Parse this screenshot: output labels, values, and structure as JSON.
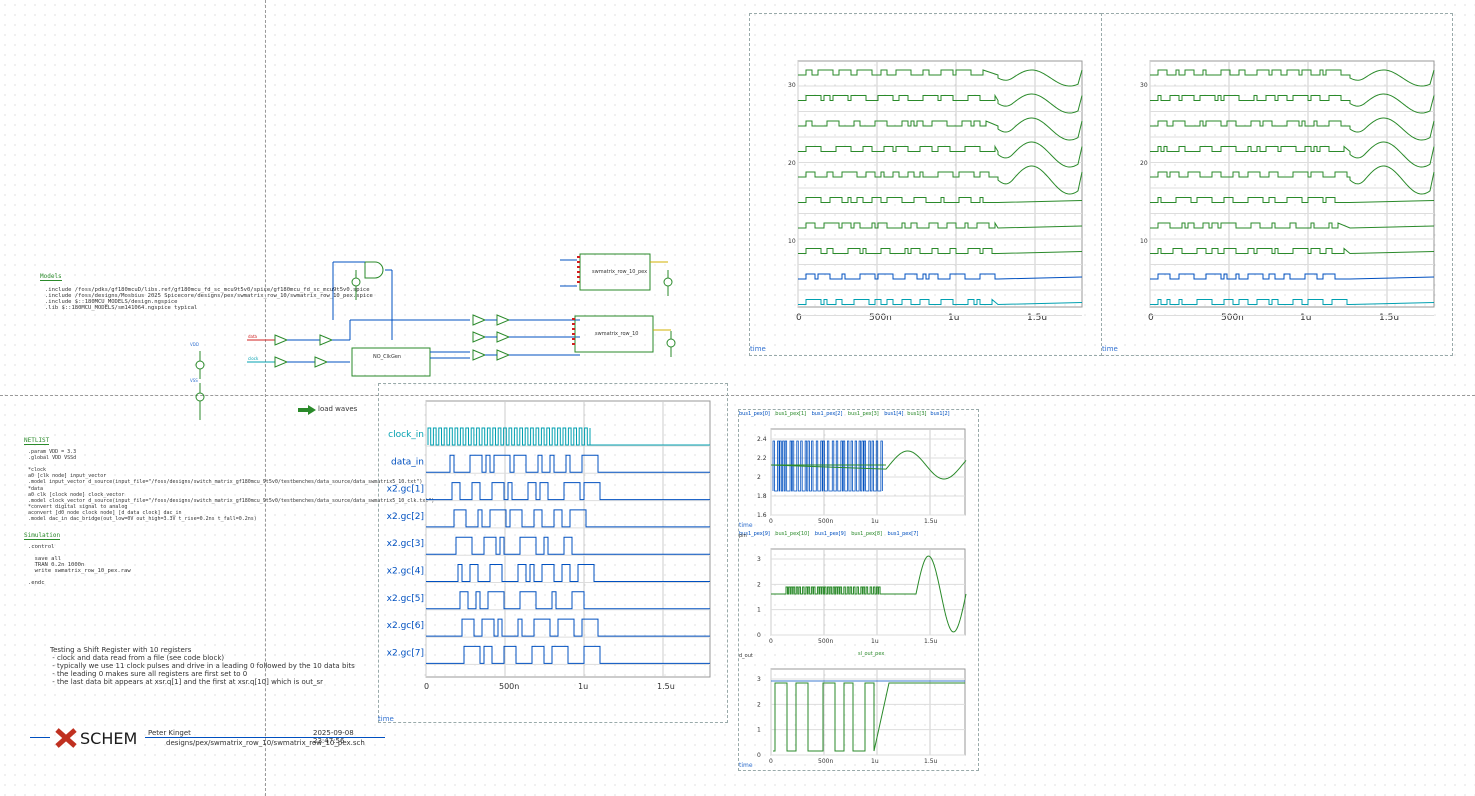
{
  "title": "",
  "model_block": {
    "header": "Models",
    "lines": [
      ".include /foss/pdks/gf180mcuD/libs.ref/gf180mcu_fd_sc_mcu9t5v0/spice/gf180mcu_fd_sc_mcu9t5v0.spice",
      ".include /foss/designs/Mosbius 2025 Spicecore/designs/pex/swmatrix_row_10/swmatrix_row_10_pex.spice",
      ".include $::180MCU_MODELS/design.ngspice",
      ".lib $::180MCU_MODELS/sm141064.ngspice typical"
    ]
  },
  "netlist_block": {
    "header": "NETLIST",
    "lines": [
      ".param VDD = 3.3",
      ".global VDD VSSd",
      "",
      "*clock",
      "a0 [clk node] input_vector",
      ".model input_vector d_source(input_file=\"/foss/designs/switch_matrix_gf180mcu_9t5v0/testbenches/data_source/data_swmatrix5_10.txt\")",
      "*data",
      "a0 clk [clock node] clock_vector",
      ".model clock_vector d_source(input_file=\"/foss/designs/switch_matrix_gf180mcu_9t5v0/testbenches/data_source/data_swmatrix5_10_clk.txt\")",
      "*convert digital signal to analog",
      "aconvert [d0 node clock node] [d data clock] dac_in",
      ".model dac_in dac_bridge(out_low=0V out_high=3.3V t_rise=0.2ns t_fall=0.2ns)"
    ]
  },
  "simulation_block": {
    "header": "Simulation",
    "lines": [
      ".control",
      "",
      "  save all",
      "  TRAN 0.2n 1000n",
      "  write swmatrix_row_10_pex.raw",
      "",
      ".endc"
    ]
  },
  "description": {
    "lines": [
      "Testing a Shift Register with 10 registers",
      " - clock and data read from a file (see code block)",
      " - typically we use 11 clock pulses and drive in a leading 0 followed by the 10 data bits",
      " - the leading 0 makes sure all registers are first set to 0",
      " - the last data bit appears at xsr.q[1] and the first at xsr.q[10] which is out_sr"
    ]
  },
  "footer": {
    "logo": "SCHEM",
    "author": "Peter Kinget",
    "date": "2025-09-08  23:47:56",
    "path": "designs/pex/swmatrix_row_10/swmatrix_row_10_pex.sch"
  },
  "load_waves_label": "load waves",
  "schematic": {
    "block_nocl": "NO_ClkGen",
    "block_row": "swmatrix_row_10",
    "block_row_pex": "swmatrix_row_10_pex",
    "net_data": "data",
    "net_clock": "clock",
    "label_vdd": "VDD",
    "label_vss": "VSS"
  },
  "waveform_main": {
    "time_label": "time",
    "x_ticks": [
      "0",
      "500n",
      "1u",
      "1.5u"
    ],
    "signals": [
      "clock_in",
      "data_in",
      "x2.gc[1]",
      "x2.gc[2]",
      "x2.gc[3]",
      "x2.gc[4]",
      "x2.gc[5]",
      "x2.gc[6]",
      "x2.gc[7]"
    ]
  },
  "waveform_top_left": {
    "time_label": "time",
    "x_ticks": [
      "0",
      "500n",
      "1u",
      "1.5u"
    ],
    "y_ticks": [
      "30",
      "20",
      "10"
    ]
  },
  "waveform_top_right": {
    "time_label": "time",
    "x_ticks": [
      "0",
      "500n",
      "1u",
      "1.5u"
    ],
    "y_ticks": [
      "30",
      "20",
      "10"
    ]
  },
  "waveform_small_1": {
    "legend": [
      "bus1_pex[0]",
      "bus1_pex[1]",
      "bus1_pex[2]",
      "bus1_pex[3]",
      "bus1[4]",
      "bus1[3]",
      "bus1[2]"
    ],
    "y_ticks": [
      "2.4",
      "2.2",
      "2",
      "1.8",
      "1.6"
    ],
    "x_ticks": [
      "0",
      "500n",
      "1u",
      "1.5u"
    ],
    "time_label": "time"
  },
  "waveform_small_2": {
    "side_label": "pin",
    "legend": [
      "bus1_pex[9]",
      "bus1_pex[10]",
      "bus1_pex[9]",
      "bus1_pex[8]",
      "bus1_pex[7]"
    ],
    "y_ticks": [
      "3",
      "2",
      "1",
      "0"
    ],
    "x_ticks": [
      "0",
      "500n",
      "1u",
      "1.5u"
    ]
  },
  "waveform_small_3": {
    "side_label": "d_out",
    "title": "sl_out_pex",
    "y_ticks": [
      "3",
      "2",
      "1",
      "0"
    ],
    "x_ticks": [
      "0",
      "500n",
      "1u",
      "1.5u"
    ],
    "time_label": "time"
  },
  "colors": {
    "green": "#2a8a2a",
    "blue": "#0050c0",
    "cyan": "#00a0b0",
    "dark_green": "#1a6a1a"
  }
}
